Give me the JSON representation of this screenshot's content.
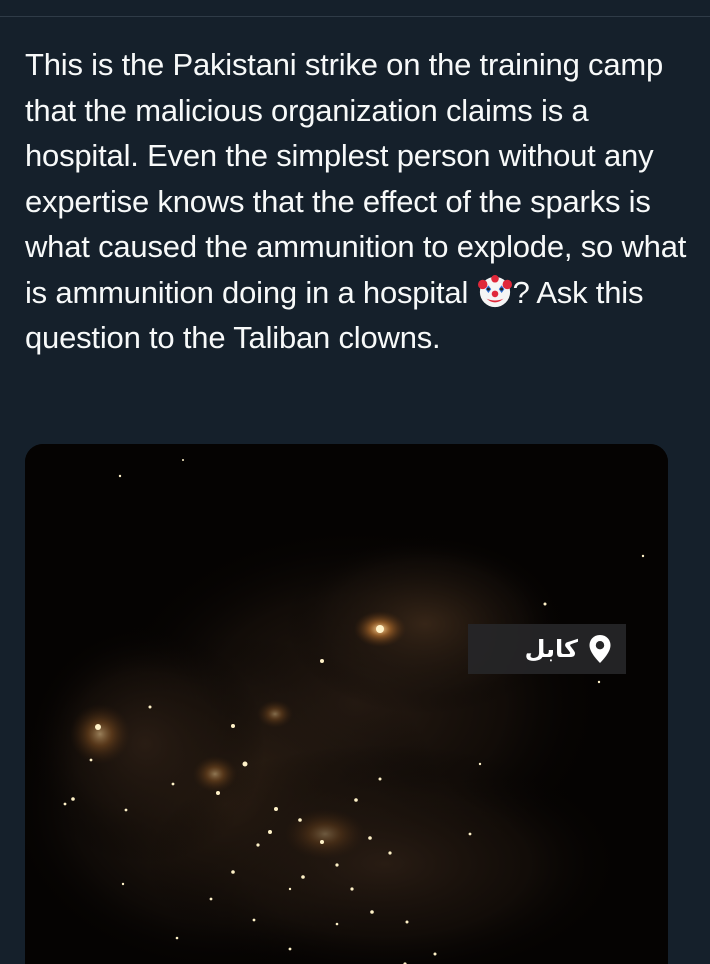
{
  "post": {
    "text_parts": [
      "This is the Pakistani strike on the training camp that the malicious organization claims is a hospital. Even the simplest person without any expertise knows that the effect of the sparks is what caused the ammunition to explode, so what is ammunition doing in a hospital ",
      "? Ask this question to the Taliban clowns."
    ],
    "emoji": "clown-face"
  },
  "media": {
    "location_label": "كابل",
    "icons": {
      "location": "map-pin-icon"
    }
  },
  "colors": {
    "background": "#15202b",
    "text": "#f7f9f9",
    "tag_background": "#262628"
  }
}
